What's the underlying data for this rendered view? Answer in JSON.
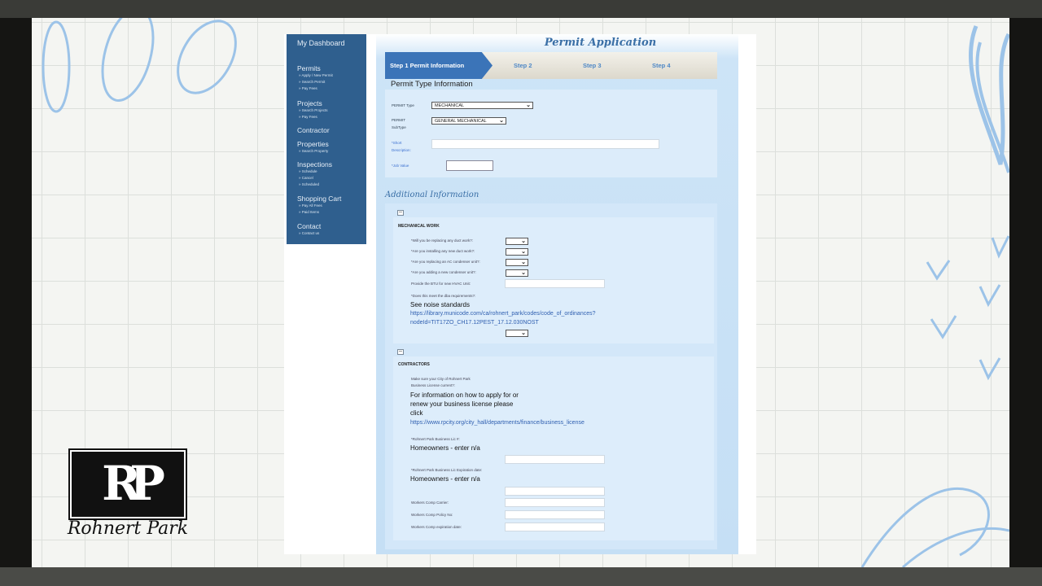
{
  "brand": {
    "logo_mark": "RP",
    "logo_name": "Rohnert Park"
  },
  "nav": {
    "dashboard": "My Dashboard",
    "sections": [
      {
        "label": "Permits",
        "items": [
          "Apply / New Permit",
          "Search Permit",
          "Pay Fees"
        ]
      },
      {
        "label": "Projects",
        "items": [
          "Search Projects",
          "Pay Fees"
        ]
      },
      {
        "label": "Contractor",
        "items": []
      },
      {
        "label": "Properties",
        "items": [
          "Search Property"
        ]
      },
      {
        "label": "Inspections",
        "items": [
          "Schedule",
          "Cancel",
          "Scheduled"
        ]
      },
      {
        "label": "Shopping Cart",
        "items": [
          "Pay All Fees",
          "Paid Items"
        ]
      },
      {
        "label": "Contact",
        "items": [
          "Contact us"
        ]
      }
    ]
  },
  "page": {
    "title": "Permit Application"
  },
  "steps": [
    "Step 1  Permit Information",
    "Step 2",
    "Step 3",
    "Step 4"
  ],
  "permit_type": {
    "heading": "Permit Type Information",
    "type_label": "PERMIT Type",
    "type_value": "MECHANICAL",
    "subtype_label1": "PERMIT",
    "subtype_label2": "SubType",
    "subtype_value": "GENERAL MECHANICAL",
    "short_desc_label1": "*Short",
    "short_desc_label2": "Description:",
    "job_value_label": "*Job Value"
  },
  "additional": {
    "heading": "Additional Information",
    "mech_heading": "MECHANICAL WORK",
    "questions": [
      "*Will you be replacing any duct work?:",
      "*Are you installing any new duct work?:",
      "*Are you replacing an AC condenser unit?:",
      "*Are you adding a new condenser unit?:"
    ],
    "btu_label": "Provide the BTU for new HVAC Unit:",
    "noise_q": "*Does this meet the dba requirements?:",
    "noise_text": "See noise standards",
    "noise_link1": "https://library.municode.com/ca/rohnert_park/codes/code_of_ordinances?",
    "noise_link2": "nodeId=TIT17ZO_CH17.12PEST_17.12.030NOST",
    "contractors_heading": "CONTRACTORS",
    "license_q1": "Make sure your City of Rohnert Park",
    "license_q2": "Business License current?:",
    "license_text1": "For information on how to apply for or",
    "license_text2": "renew your business license please",
    "license_text3": "click",
    "license_link": "https://www.rpcity.org/city_hall/departments/finance/business_license",
    "lic_num_label": "*Rohnert Park Business Lic #:",
    "lic_num_hint": "Homeowners - enter n/a",
    "lic_exp_label": "*Rohnert Park Business Lic Expiration date:",
    "lic_exp_hint": "Homeowners - enter n/a",
    "wc_carrier": "Workers Comp Carrier:",
    "wc_policy": "Workers Comp Policy No:",
    "wc_exp": "Workers Comp expiration date:"
  }
}
